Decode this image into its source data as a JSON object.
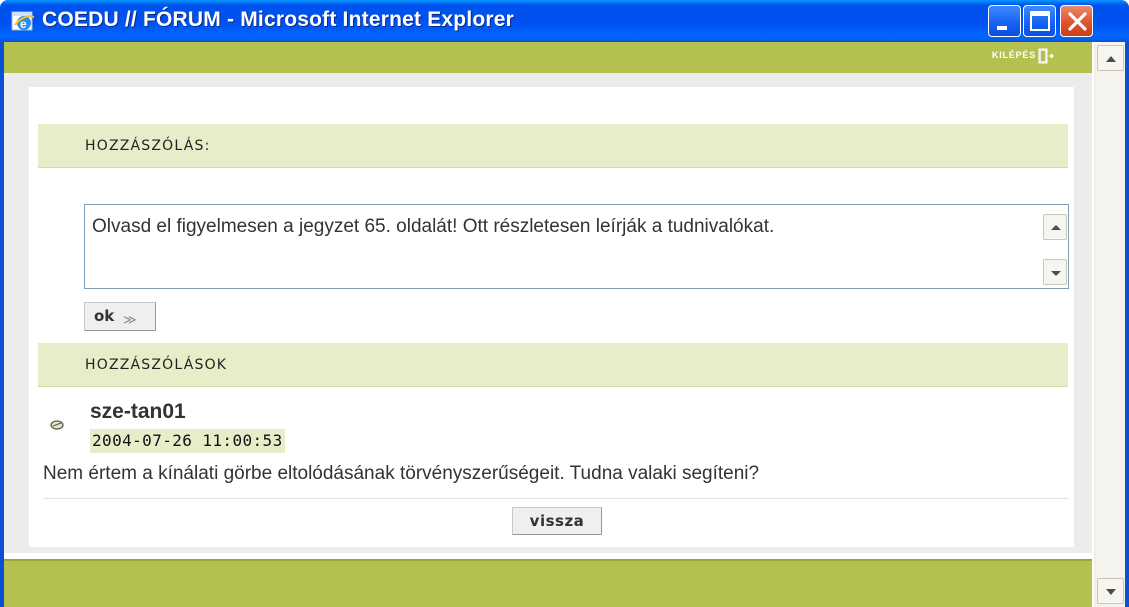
{
  "window": {
    "title": "COEDU // FÓRUM - Microsoft Internet Explorer",
    "controls": [
      "minimize",
      "maximize",
      "close"
    ]
  },
  "topbar": {
    "logout_label": "KILÉPÉS",
    "logout_icon": "exit-door-icon",
    "color": "#b5c14f"
  },
  "reply_section": {
    "header": "HOZZÁSZÓLÁS:",
    "textarea_value": "Olvasd el figyelmesen a jegyzet 65. oldalát! Ott részletesen leírják a tudnivalókat.",
    "submit_label": "ok",
    "submit_chevron": "≫"
  },
  "comments_section": {
    "header": "HOZZÁSZÓLÁSOK",
    "comments": [
      {
        "author": "sze-tan01",
        "timestamp": "2004-07-26 11:00:53",
        "text": "Nem értem a kínálati görbe eltolódásának törvényszerűségeit. Tudna valaki segíteni?"
      }
    ],
    "back_label": "vissza"
  },
  "colors": {
    "accent_green": "#b5c14f",
    "header_bg": "#e9ecc8",
    "title_blue": "#0053ee"
  }
}
